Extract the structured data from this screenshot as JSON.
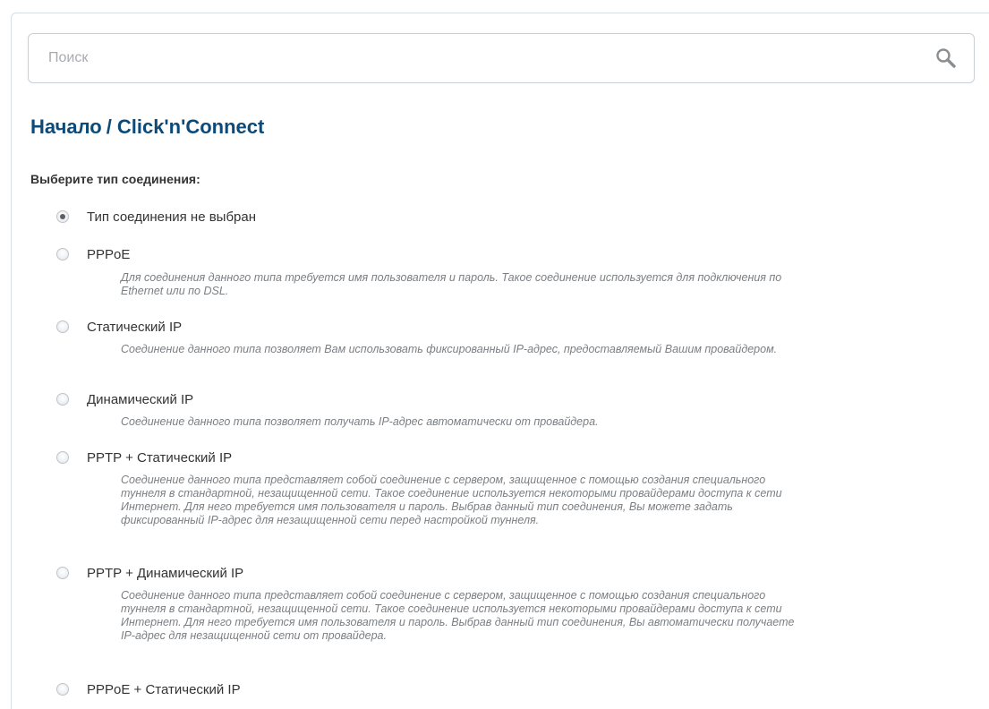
{
  "search": {
    "placeholder": "Поиск",
    "value": "",
    "icon": "search-icon"
  },
  "breadcrumb": {
    "home": "Начало",
    "separator": "/",
    "current": "Click'n'Connect"
  },
  "connection_type": {
    "label": "Выберите тип соединения:",
    "selected": "Тип соединения не выбран",
    "options": [
      {
        "label": "Тип соединения не выбран",
        "checked": true,
        "description": ""
      },
      {
        "label": "PPPoE",
        "checked": false,
        "description": "Для соединения данного типа требуется имя пользователя и пароль. Такое соединение используется для подключения по Ethernet или по DSL."
      },
      {
        "label": "Статический IP",
        "checked": false,
        "description": "Соединение данного типа позволяет Вам использовать фиксированный IP-адрес, предоставляемый Вашим провайдером."
      },
      {
        "label": "Динамический IP",
        "checked": false,
        "description": "Соединение данного типа позволяет получать IP-адрес автоматически от провайдера."
      },
      {
        "label": "PPTP + Статический IP",
        "checked": false,
        "description": "Соединение данного типа представляет собой соединение с сервером, защищенное с помощью создания специального туннеля в стандартной, незащищенной сети. Такое соединение используется некоторыми провайдерами доступа к сети Интернет. Для него требуется имя пользователя и пароль. Выбрав данный тип соединения, Вы можете задать фиксированный IP-адрес для незащищенной сети перед настройкой туннеля."
      },
      {
        "label": "PPTP + Динамический IP",
        "checked": false,
        "description": "Соединение данного типа представляет собой соединение с сервером, защищенное с помощью создания специального туннеля в стандартной, незащищенной сети. Такое соединение используется некоторыми провайдерами доступа к сети Интернет. Для него требуется имя пользователя и пароль. Выбрав данный тип соединения, Вы автоматически получаете IP-адрес для незащищенной сети от провайдера."
      },
      {
        "label": "PPPoE + Статический IP",
        "checked": false,
        "description": ""
      }
    ]
  }
}
